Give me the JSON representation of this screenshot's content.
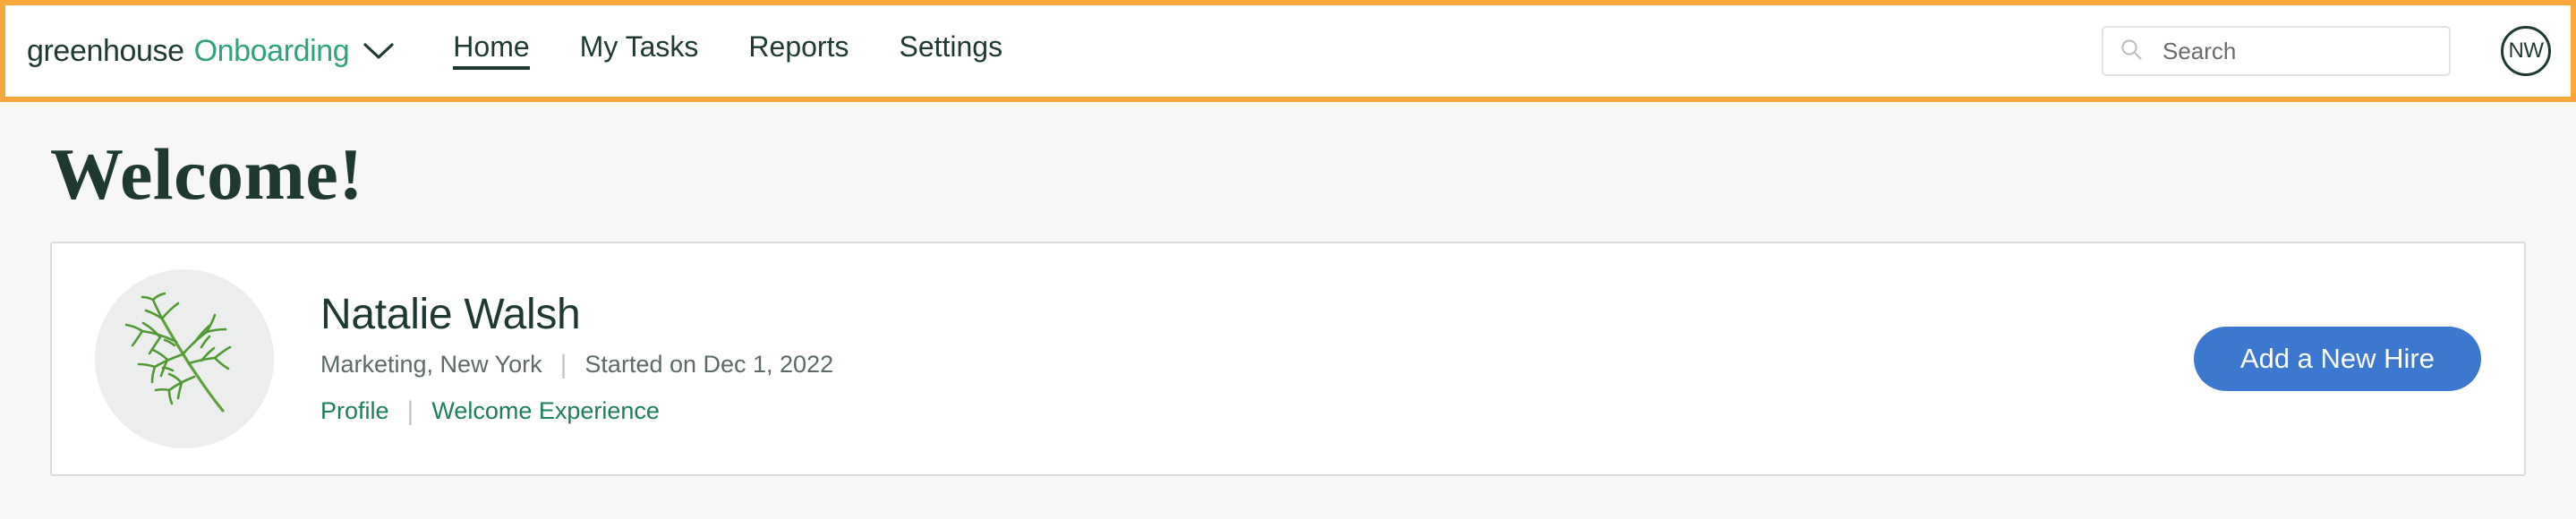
{
  "header": {
    "brand": {
      "primary": "greenhouse",
      "secondary": "Onboarding",
      "chevron_icon": "chevron-down-icon"
    },
    "nav_items": [
      {
        "label": "Home",
        "active": true
      },
      {
        "label": "My Tasks",
        "active": false
      },
      {
        "label": "Reports",
        "active": false
      },
      {
        "label": "Settings",
        "active": false
      }
    ],
    "search": {
      "placeholder": "Search",
      "value": "",
      "icon": "search-icon"
    },
    "user": {
      "initials": "NW"
    },
    "highlight_color": "#f7a83c"
  },
  "page": {
    "title": "Welcome!"
  },
  "new_hire_card": {
    "avatar_icon": "dill-sprig-illustration",
    "name": "Natalie Walsh",
    "department_location": "Marketing, New York",
    "start_date": "Started on Dec 1, 2022",
    "divider": "|",
    "links": [
      {
        "label": "Profile"
      },
      {
        "label": "Welcome Experience"
      }
    ],
    "action_button": {
      "label": "Add a New Hire",
      "color": "#3d78d0"
    }
  },
  "colors": {
    "brand_dark": "#1e3932",
    "brand_green": "#2fa37a",
    "link_green": "#1c7f56",
    "page_background": "#f7f7f7",
    "card_border": "#d8dcdb"
  }
}
